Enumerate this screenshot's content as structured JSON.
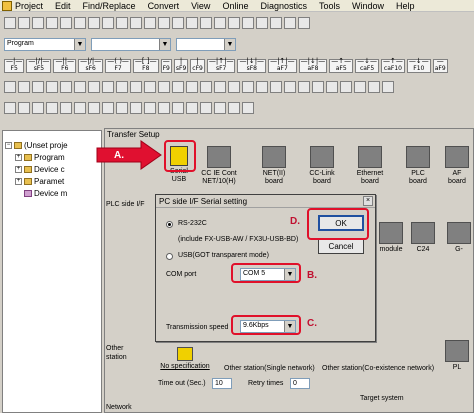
{
  "menu": {
    "items": [
      "Project",
      "Edit",
      "Find/Replace",
      "Convert",
      "View",
      "Online",
      "Diagnostics",
      "Tools",
      "Window",
      "Help"
    ]
  },
  "toolbar": {
    "program_select": "Program",
    "fkeys": [
      {
        "sym": "—|—",
        "label": "F5"
      },
      {
        "sym": "—|/|—",
        "label": "sF5"
      },
      {
        "sym": "—||—",
        "label": "F6"
      },
      {
        "sym": "—|/|—",
        "label": "sF6"
      },
      {
        "sym": "—( )—",
        "label": "F7"
      },
      {
        "sym": "—[ ]—",
        "label": "F8"
      },
      {
        "sym": "—",
        "label": "F9"
      },
      {
        "sym": "|",
        "label": "sF9"
      },
      {
        "sym": "|",
        "label": "cF9"
      },
      {
        "sym": "—|↑|—",
        "label": "sF7"
      },
      {
        "sym": "—|↓|—",
        "label": "sF8"
      },
      {
        "sym": "—|↑|—",
        "label": "aF7"
      },
      {
        "sym": "—|↓|—",
        "label": "aF8"
      },
      {
        "sym": "—↑—",
        "label": "aF5"
      },
      {
        "sym": "—↓—",
        "label": "caF5"
      },
      {
        "sym": "—↑—",
        "label": "caF10"
      },
      {
        "sym": "—↓—",
        "label": "F10"
      },
      {
        "sym": "—",
        "label": "aF9"
      }
    ]
  },
  "project_tree": {
    "items": [
      "(Unset proje",
      "Program",
      "Device c",
      "Paramet",
      "Device m"
    ]
  },
  "transfer_setup": {
    "title": "Transfer Setup",
    "pc_if_buttons": [
      {
        "label1": "Serial",
        "label2": "USB"
      },
      {
        "label1": "CC IE Cont",
        "label2": "NET/10(H)"
      },
      {
        "label1": "NET(II)",
        "label2": "board"
      },
      {
        "label1": "CC-Link",
        "label2": "board"
      },
      {
        "label1": "Ethernet",
        "label2": "board"
      },
      {
        "label1": "PLC",
        "label2": "board"
      },
      {
        "label1": "AF",
        "label2": "board"
      }
    ],
    "plc_side_label": "PLC side I/F",
    "plc_side_buttons": [
      "module",
      "C24",
      "G-"
    ],
    "other_station_label": "Other\nstation",
    "other_station_options": [
      "No specification",
      "Other station(Single network)",
      "Other station(Co-existence network)"
    ],
    "network_label": "Network",
    "timeout_label": "Time out (Sec.)",
    "timeout_value": "10",
    "retry_label": "Retry times",
    "retry_value": "0",
    "target_system_label": "Target system",
    "pl_label": "PL"
  },
  "serial_dialog": {
    "title": "PC side I/F  Serial setting",
    "rs232c_label": "RS-232C",
    "rs232c_note": "(include FX-USB-AW / FX3U-USB-BD)",
    "usb_label": "USB(GOT transparent mode)",
    "com_port_label": "COM port",
    "com_port_value": "COM 5",
    "speed_label": "Transmission speed",
    "speed_value": "9.6Kbps",
    "ok_label": "OK",
    "cancel_label": "Cancel"
  },
  "annotations": {
    "a": "A.",
    "b": "B.",
    "c": "C.",
    "d": "D."
  },
  "colors": {
    "annotation_red": "#e0102a",
    "arrow_red": "#e01030",
    "window_bg": "#d4d0c8"
  }
}
